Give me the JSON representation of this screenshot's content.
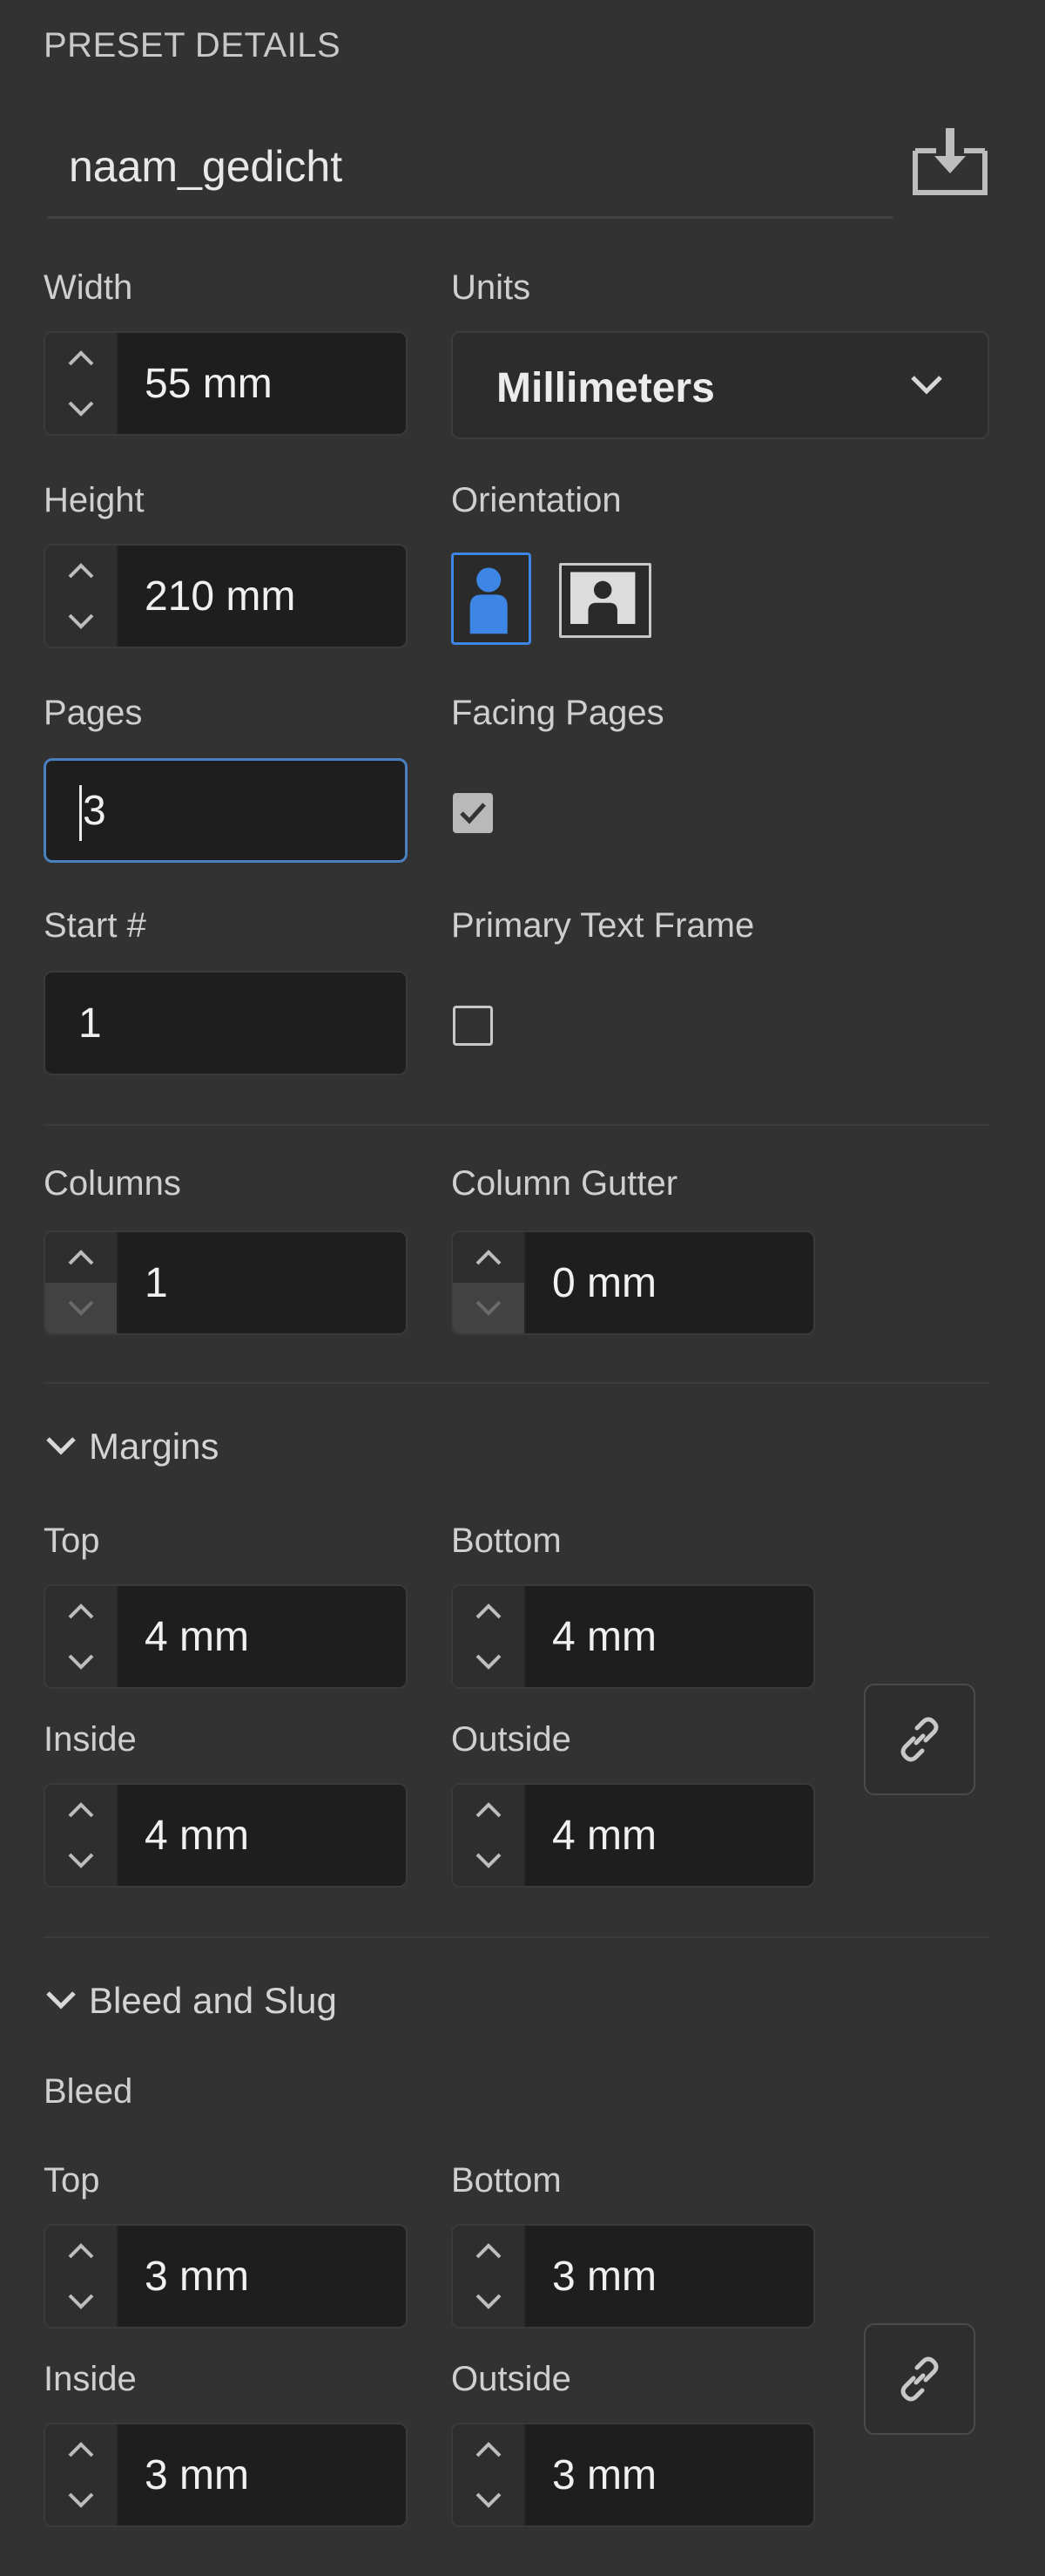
{
  "panel": {
    "section_title": "PRESET DETAILS",
    "preset_name": "naam_gedicht",
    "save_icon": "save-preset-icon"
  },
  "fields": {
    "width": {
      "label": "Width",
      "value": "55 mm"
    },
    "units": {
      "label": "Units",
      "value": "Millimeters"
    },
    "height": {
      "label": "Height",
      "value": "210 mm"
    },
    "orientation": {
      "label": "Orientation",
      "selected": "portrait"
    },
    "pages": {
      "label": "Pages",
      "value": "3"
    },
    "facing_pages": {
      "label": "Facing Pages",
      "checked": true
    },
    "start": {
      "label": "Start #",
      "value": "1"
    },
    "primary_text_frame": {
      "label": "Primary Text Frame",
      "checked": false
    },
    "columns": {
      "label": "Columns",
      "value": "1"
    },
    "column_gutter": {
      "label": "Column Gutter",
      "value": "0 mm"
    }
  },
  "margins": {
    "header": "Margins",
    "top": {
      "label": "Top",
      "value": "4 mm"
    },
    "bottom": {
      "label": "Bottom",
      "value": "4 mm"
    },
    "inside": {
      "label": "Inside",
      "value": "4 mm"
    },
    "outside": {
      "label": "Outside",
      "value": "4 mm"
    }
  },
  "bleed_slug": {
    "header": "Bleed and Slug",
    "bleed_label": "Bleed",
    "top": {
      "label": "Top",
      "value": "3 mm"
    },
    "bottom": {
      "label": "Bottom",
      "value": "3 mm"
    },
    "inside": {
      "label": "Inside",
      "value": "3 mm"
    },
    "outside": {
      "label": "Outside",
      "value": "3 mm"
    }
  },
  "colors": {
    "background": "#323232",
    "field_bg": "#1e1e1e",
    "accent": "#3e86e6",
    "focus_border": "#4a7fc0"
  }
}
